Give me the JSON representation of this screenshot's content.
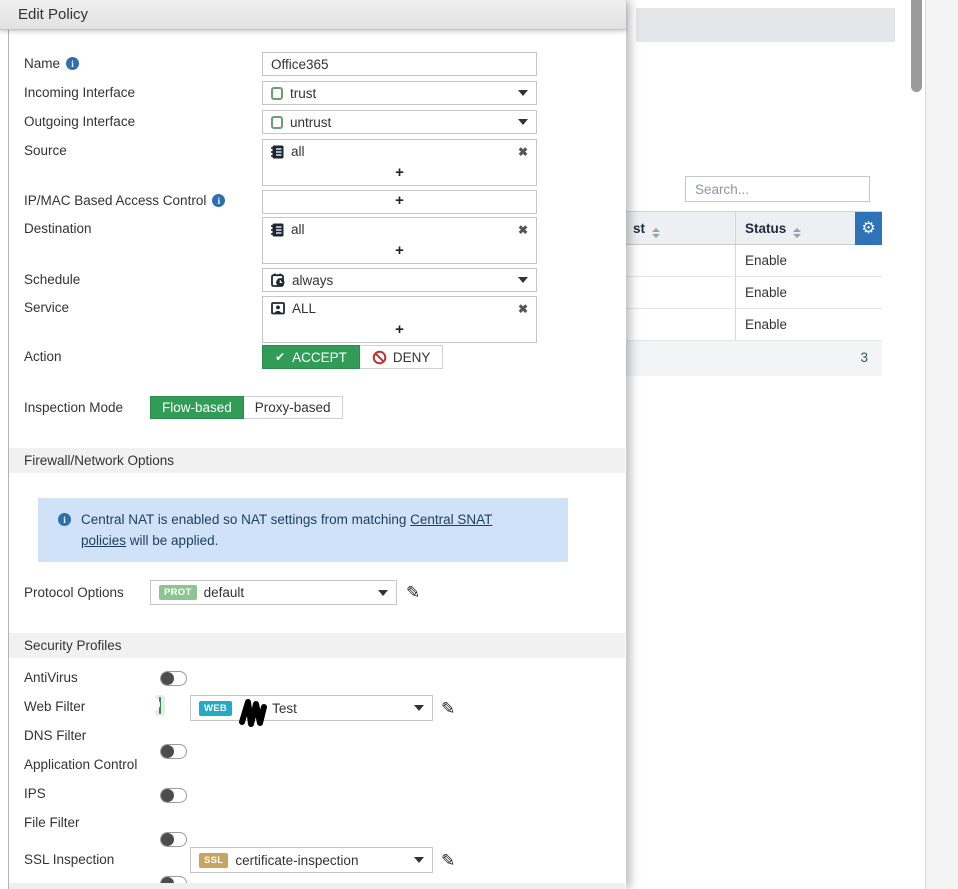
{
  "dialog": {
    "title": "Edit Policy",
    "name": {
      "label": "Name",
      "value": "Office365"
    },
    "incoming": {
      "label": "Incoming Interface",
      "value": "trust"
    },
    "outgoing": {
      "label": "Outgoing Interface",
      "value": "untrust"
    },
    "source": {
      "label": "Source",
      "value": "all",
      "add": "+"
    },
    "ipmac": {
      "label": "IP/MAC Based Access Control",
      "add": "+"
    },
    "destination": {
      "label": "Destination",
      "value": "all",
      "add": "+"
    },
    "schedule": {
      "label": "Schedule",
      "value": "always"
    },
    "service": {
      "label": "Service",
      "value": "ALL",
      "add": "+"
    },
    "action": {
      "label": "Action",
      "accept": "ACCEPT",
      "deny": "DENY"
    },
    "inspection": {
      "label": "Inspection Mode",
      "flow": "Flow-based",
      "proxy": "Proxy-based"
    },
    "sections": {
      "firewall": "Firewall/Network Options",
      "security": "Security Profiles"
    },
    "nat_alert": {
      "before": "Central NAT is enabled so NAT settings from matching ",
      "link": "Central SNAT policies",
      "after": " will be applied."
    },
    "protocol": {
      "label": "Protocol Options",
      "badge": "PROT",
      "value": "default"
    },
    "profiles": {
      "antivirus": {
        "label": "AntiVirus"
      },
      "webfilter": {
        "label": "Web Filter",
        "badge": "WEB",
        "value": "Test"
      },
      "dnsfilter": {
        "label": "DNS Filter"
      },
      "appcontrol": {
        "label": "Application Control"
      },
      "ips": {
        "label": "IPS"
      },
      "filefilter": {
        "label": "File Filter"
      }
    },
    "ssl": {
      "label": "SSL Inspection",
      "badge": "SSL",
      "value": "certificate-inspection"
    }
  },
  "background": {
    "search": {
      "placeholder": "Search..."
    },
    "table": {
      "col_partial": "st",
      "col_status": "Status",
      "rows": [
        "Enable",
        "Enable",
        "Enable"
      ],
      "total": "3"
    }
  },
  "colors": {
    "accent_green": "#319c56",
    "web_badge": "#24a9c6",
    "prot_badge": "#8ec492",
    "ssl_badge": "#c9a35f",
    "gear_blue": "#2e72b8",
    "info_blue": "#2f6fae",
    "alert_bg": "#cfe2f7"
  }
}
